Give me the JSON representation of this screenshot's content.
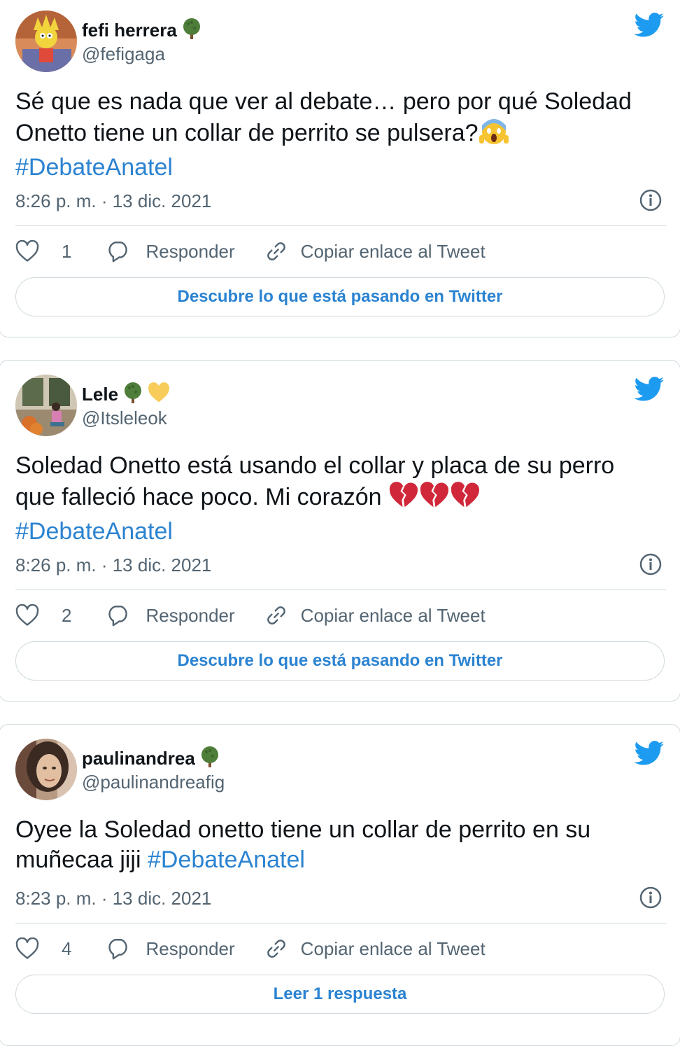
{
  "tweets": [
    {
      "name": "fefi herrera",
      "handle": "@fefigaga",
      "text": "Sé que es nada que ver al debate… pero por qué Soledad Onetto tiene un collar de perrito se pulsera?",
      "hashtag": "#DebateAnatel",
      "time": "8:26 p. m. · 13 dic. 2021",
      "likes": "1",
      "reply_label": "Responder",
      "copy_label": "Copiar enlace al Tweet",
      "cta": "Descubre lo que está pasando en Twitter"
    },
    {
      "name": "Lele",
      "handle": "@Itsleleok",
      "text": "Soledad Onetto está usando el collar y placa de su perro que falleció hace poco. Mi corazón",
      "hashtag": "#DebateAnatel",
      "time": "8:26 p. m. · 13 dic. 2021",
      "likes": "2",
      "reply_label": "Responder",
      "copy_label": "Copiar enlace al Tweet",
      "cta": "Descubre lo que está pasando en Twitter"
    },
    {
      "name": "paulinandrea",
      "handle": "@paulinandreafig",
      "text": "Oyee la Soledad onetto tiene un collar de perrito en su muñecaa jiji",
      "hashtag": "#DebateAnatel",
      "time": "8:23 p. m. · 13 dic. 2021",
      "likes": "4",
      "reply_label": "Responder",
      "copy_label": "Copiar enlace al Tweet",
      "cta": "Leer 1 respuesta"
    }
  ],
  "colors": {
    "link": "#2b83d1",
    "muted": "#536471",
    "twitter_blue": "#1d9bf0",
    "border": "#cfd9de"
  },
  "icons": [
    "twitter-bird-icon",
    "tree-emoji-icon",
    "yellow-heart-emoji-icon",
    "screaming-face-emoji-icon",
    "broken-heart-emoji-icon",
    "info-icon",
    "heart-icon",
    "reply-bubble-icon",
    "link-icon"
  ]
}
